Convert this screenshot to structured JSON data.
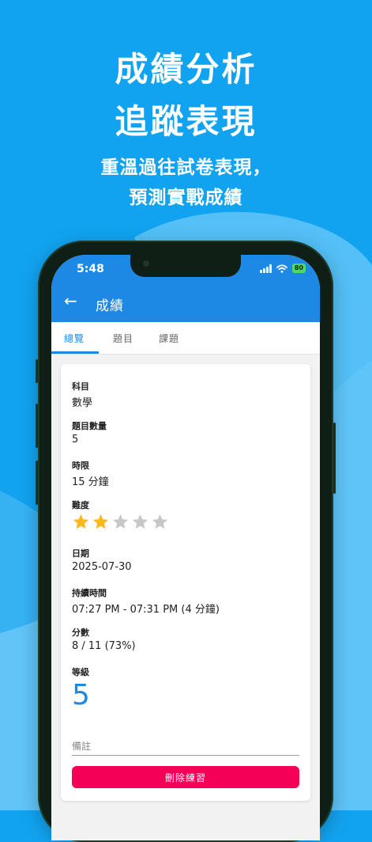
{
  "promo": {
    "title_line1": "成績分析",
    "title_line2": "追蹤表現",
    "subtitle_line1": "重溫過往試卷表現，",
    "subtitle_line2": "預測實戰成績"
  },
  "status_bar": {
    "time": "5:48",
    "battery": "80"
  },
  "appbar": {
    "title": "成績"
  },
  "tabs": [
    {
      "label": "總覽",
      "active": true
    },
    {
      "label": "題目",
      "active": false
    },
    {
      "label": "課題",
      "active": false
    }
  ],
  "details": {
    "subject_label": "科目",
    "subject_value": "數學",
    "question_count_label": "題目數量",
    "question_count_value": "5",
    "time_limit_label": "時限",
    "time_limit_value": "15 分鐘",
    "difficulty_label": "難度",
    "difficulty_rating": 2,
    "difficulty_max": 5,
    "date_label": "日期",
    "date_value": "2025-07-30",
    "duration_label": "持續時間",
    "duration_value": "07:27 PM - 07:31 PM (4 分鐘)",
    "score_label": "分數",
    "score_value": "8 / 11 (73%)",
    "grade_label": "等級",
    "grade_value": "5",
    "notes_placeholder": "備註",
    "delete_button": "刪除練習"
  },
  "colors": {
    "background": "#12a3f0",
    "appbar": "#1e88e5",
    "accent": "#1e88e5",
    "star_filled": "#fbb81a",
    "star_empty": "#c7c7c7",
    "delete_button": "#f50057"
  }
}
